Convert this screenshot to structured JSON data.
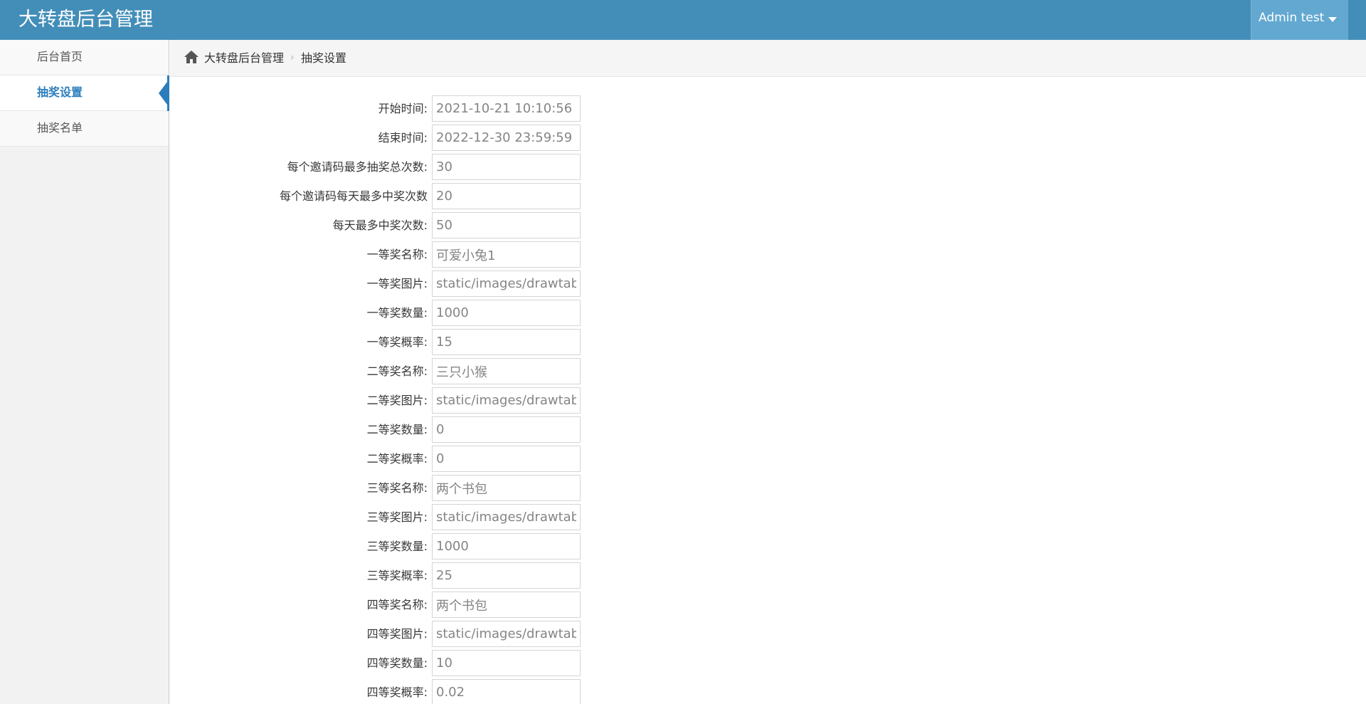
{
  "app": {
    "title": "大转盘后台管理",
    "user_label": "Admin test"
  },
  "sidebar": {
    "items": [
      {
        "label": "后台首页",
        "active": false
      },
      {
        "label": "抽奖设置",
        "active": true
      },
      {
        "label": "抽奖名单",
        "active": false
      }
    ]
  },
  "breadcrumb": {
    "icon": "home-icon",
    "items": [
      "大转盘后台管理",
      "抽奖设置"
    ],
    "separator": "›"
  },
  "form": {
    "fields": [
      {
        "label": "开始时间:",
        "value": "2021-10-21 10:10:56"
      },
      {
        "label": "结束时间:",
        "value": "2022-12-30 23:59:59"
      },
      {
        "label": "每个邀请码最多抽奖总次数:",
        "value": "30"
      },
      {
        "label": "每个邀请码每天最多中奖次数",
        "value": "20"
      },
      {
        "label": "每天最多中奖次数:",
        "value": "50"
      },
      {
        "label": "一等奖名称:",
        "value": "可爱小兔1"
      },
      {
        "label": "一等奖图片:",
        "value": "static/images/drawtable"
      },
      {
        "label": "一等奖数量:",
        "value": "1000"
      },
      {
        "label": "一等奖概率:",
        "value": "15"
      },
      {
        "label": "二等奖名称:",
        "value": "三只小猴"
      },
      {
        "label": "二等奖图片:",
        "value": "static/images/drawtable"
      },
      {
        "label": "二等奖数量:",
        "value": "0"
      },
      {
        "label": "二等奖概率:",
        "value": "0"
      },
      {
        "label": "三等奖名称:",
        "value": "两个书包"
      },
      {
        "label": "三等奖图片:",
        "value": "static/images/drawtable"
      },
      {
        "label": "三等奖数量:",
        "value": "1000"
      },
      {
        "label": "三等奖概率:",
        "value": "25"
      },
      {
        "label": "四等奖名称:",
        "value": "两个书包"
      },
      {
        "label": "四等奖图片:",
        "value": "static/images/drawtable"
      },
      {
        "label": "四等奖数量:",
        "value": "10"
      },
      {
        "label": "四等奖概率:",
        "value": "0.02"
      }
    ]
  },
  "colors": {
    "navbar": "#438eb9",
    "user_menu": "#62a8d1",
    "accent": "#2b7dbc"
  }
}
